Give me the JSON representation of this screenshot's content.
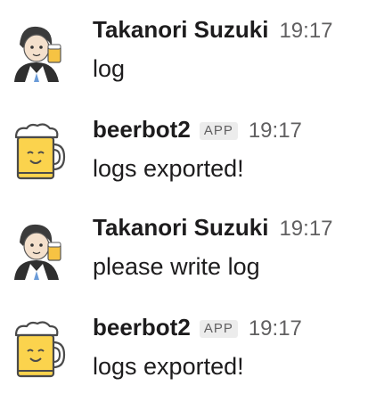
{
  "messages": [
    {
      "sender": "Takanori Suzuki",
      "badge": "",
      "time": "19:17",
      "text": "log",
      "avatar_icon": "person-illustration-avatar"
    },
    {
      "sender": "beerbot2",
      "badge": "APP",
      "time": "19:17",
      "text": "logs exported!",
      "avatar_icon": "beer-mug-avatar"
    },
    {
      "sender": "Takanori Suzuki",
      "badge": "",
      "time": "19:17",
      "text": "please write log",
      "avatar_icon": "person-illustration-avatar"
    },
    {
      "sender": "beerbot2",
      "badge": "APP",
      "time": "19:17",
      "text": "logs exported!",
      "avatar_icon": "beer-mug-avatar"
    }
  ],
  "colors": {
    "text": "#1d1c1d",
    "muted": "#616061",
    "badge_bg": "#ececec",
    "beer_fill": "#fbd34d",
    "outline": "#4a4a4a"
  }
}
